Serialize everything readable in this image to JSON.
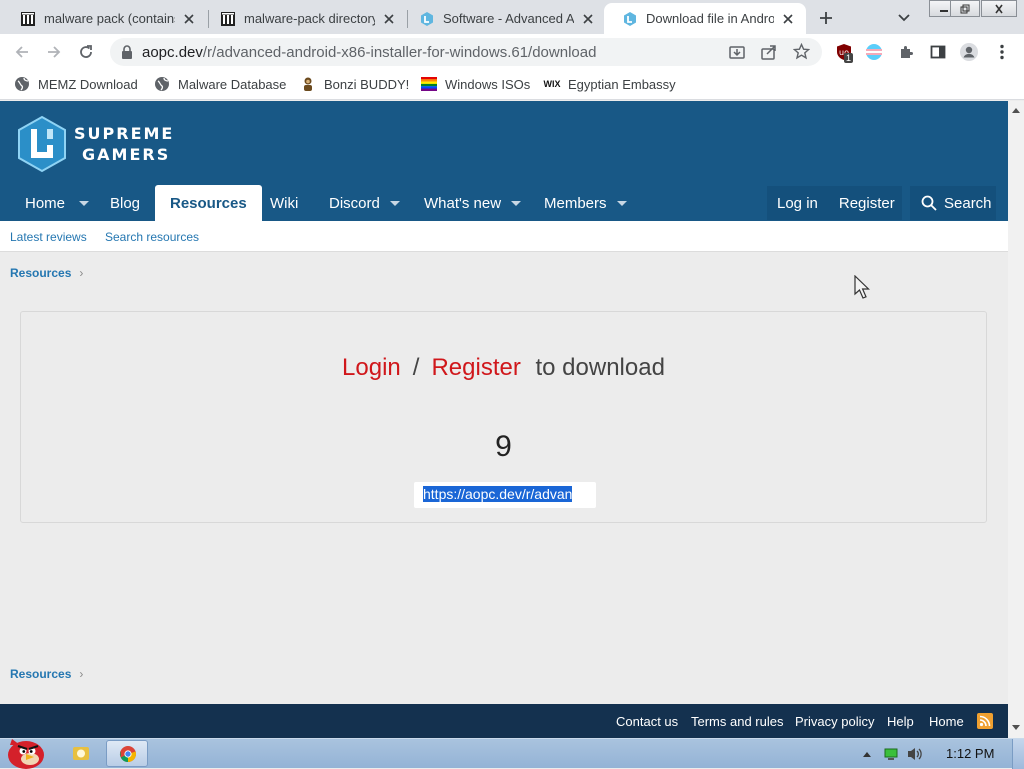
{
  "browser": {
    "tabs": [
      {
        "title": "malware pack (contains",
        "icon": "archive-icon",
        "active": false
      },
      {
        "title": "malware-pack directory",
        "icon": "archive-icon",
        "active": false
      },
      {
        "title": "Software - Advanced A",
        "icon": "site-logo-icon",
        "active": false
      },
      {
        "title": "Download file in Andro",
        "icon": "site-logo-icon",
        "active": true
      }
    ],
    "url_host": "aopc.dev",
    "url_path": "/r/advanced-android-x86-installer-for-windows.61/download",
    "extension_badge": "1",
    "bookmarks": [
      {
        "label": "MEMZ Download",
        "icon": "globe-icon"
      },
      {
        "label": "Malware Database",
        "icon": "globe-icon"
      },
      {
        "label": "Bonzi BUDDY!",
        "icon": "bonzi-icon"
      },
      {
        "label": "Windows ISOs",
        "icon": "rainbow-flag-icon"
      },
      {
        "label": "Egyptian Embassy",
        "icon": "wix-icon"
      }
    ]
  },
  "site": {
    "logo_line1": "SUPREME",
    "logo_line2": "GAMERS",
    "nav": {
      "home": "Home",
      "blog": "Blog",
      "resources": "Resources",
      "wiki": "Wiki",
      "discord": "Discord",
      "whats_new": "What's new",
      "members": "Members",
      "login": "Log in",
      "register": "Register",
      "search": "Search"
    },
    "subnav": {
      "latest_reviews": "Latest reviews",
      "search_resources": "Search resources"
    },
    "breadcrumb": "Resources",
    "download": {
      "login": "Login",
      "separator": "/",
      "register": "Register",
      "suffix": "to download",
      "countdown": "9",
      "link_text": "https://aopc.dev/r/advan"
    },
    "footer": {
      "contact": "Contact us",
      "terms": "Terms and rules",
      "privacy": "Privacy policy",
      "help": "Help",
      "home": "Home"
    }
  },
  "taskbar": {
    "clock": "1:12 PM"
  },
  "colors": {
    "header_bg": "#185886",
    "footer_bg": "#14314f",
    "accent_red": "#d0171b",
    "link_blue": "#2577b1"
  }
}
